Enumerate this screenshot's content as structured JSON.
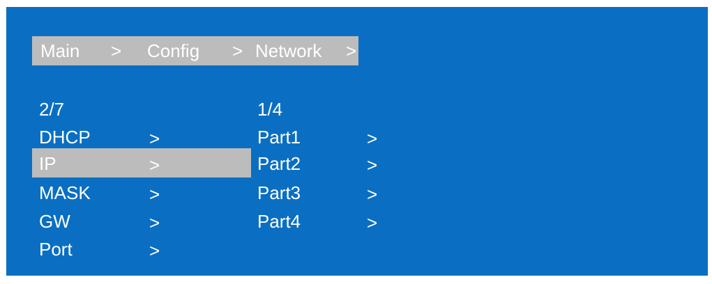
{
  "breadcrumb": {
    "items": [
      "Main",
      ">",
      "Config",
      ">",
      "Network",
      ">"
    ]
  },
  "left_menu": {
    "page_indicator": "2/7",
    "items": [
      {
        "label": "DHCP",
        "arrow": ">"
      },
      {
        "label": "IP",
        "arrow": ">",
        "selected": true
      },
      {
        "label": "MASK",
        "arrow": ">"
      },
      {
        "label": "GW",
        "arrow": ">"
      },
      {
        "label": "Port",
        "arrow": ">"
      }
    ]
  },
  "right_menu": {
    "page_indicator": "1/4",
    "items": [
      {
        "label": "Part1",
        "arrow": ">"
      },
      {
        "label": "Part2",
        "arrow": ">"
      },
      {
        "label": "Part3",
        "arrow": ">"
      },
      {
        "label": "Part4",
        "arrow": ">"
      }
    ]
  },
  "colors": {
    "background": "#0a6fc2",
    "highlight": "#bcbcbc",
    "text": "#ffffff"
  }
}
